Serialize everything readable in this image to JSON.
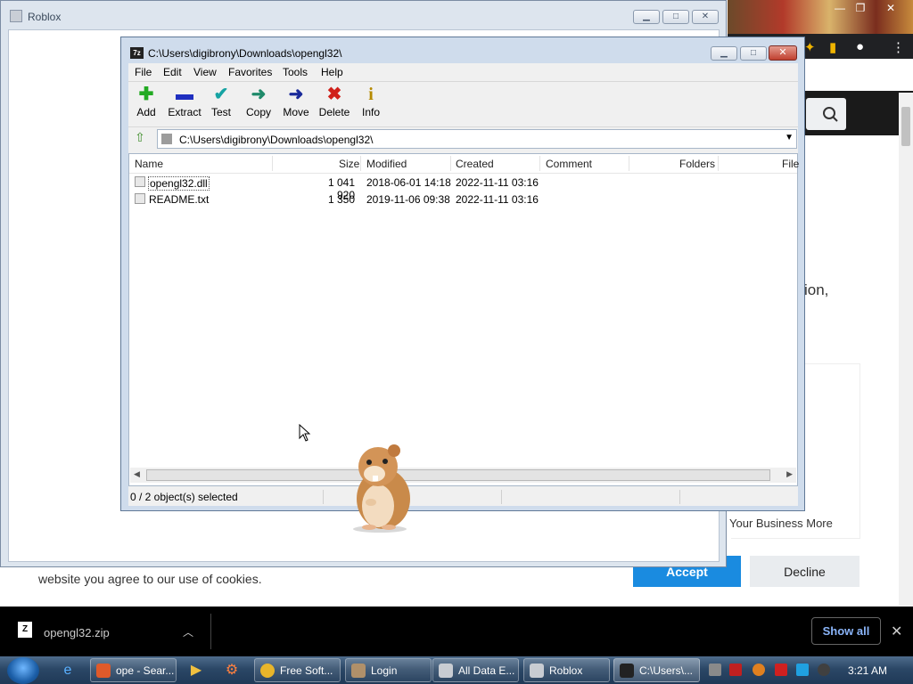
{
  "roblox_window": {
    "title": "Roblox"
  },
  "zip_window": {
    "title": "C:\\Users\\digibrony\\Downloads\\opengl32\\",
    "menu": [
      "File",
      "Edit",
      "View",
      "Favorites",
      "Tools",
      "Help"
    ],
    "toolbar": [
      {
        "label": "Add",
        "icon": "plus-icon",
        "glyph": "+",
        "color": "#22aa22"
      },
      {
        "label": "Extract",
        "icon": "minus-icon",
        "glyph": "▬",
        "color": "#1f2fbf"
      },
      {
        "label": "Test",
        "icon": "check-icon",
        "glyph": "✔",
        "color": "#16a3a3"
      },
      {
        "label": "Copy",
        "icon": "copy-arrow-icon",
        "glyph": "➜",
        "color": "#1f8a6a"
      },
      {
        "label": "Move",
        "icon": "move-arrow-icon",
        "glyph": "➜",
        "color": "#1a2a9a"
      },
      {
        "label": "Delete",
        "icon": "delete-x-icon",
        "glyph": "✖",
        "color": "#d0201a"
      },
      {
        "label": "Info",
        "icon": "info-icon",
        "glyph": "i",
        "color": "#b58a00"
      }
    ],
    "path": "C:\\Users\\digibrony\\Downloads\\opengl32\\",
    "columns": [
      "Name",
      "Size",
      "Modified",
      "Created",
      "Comment",
      "Folders",
      "File"
    ],
    "files": [
      {
        "name": "opengl32.dll",
        "size": "1 041 920",
        "modified": "2018-06-01 14:18",
        "created": "2022-11-11 03:16"
      },
      {
        "name": "README.txt",
        "size": "1 350",
        "modified": "2019-11-06 09:38",
        "created": "2022-11-11 03:16"
      }
    ],
    "status": "0 / 2 object(s) selected"
  },
  "background_page": {
    "partial_text": "ion,",
    "card_text": "Your Business More",
    "cookie_text": "website you agree to our use of cookies.",
    "accept_label": "Accept",
    "decline_label": "Decline"
  },
  "download_bar": {
    "file_name": "opengl32.zip",
    "show_all_label": "Show all"
  },
  "taskbar": {
    "tasks": [
      {
        "label": "ope - Sear...",
        "icon": "search-app-icon",
        "color": "#e05a2a"
      },
      {
        "label": "Free Soft...",
        "icon": "chrome-icon",
        "color": "#e8b52a"
      },
      {
        "label": "Login",
        "icon": "login-app-icon",
        "color": "#b0906a"
      },
      {
        "label": "All Data E...",
        "icon": "window-icon",
        "color": "#c8ccd2"
      },
      {
        "label": "Roblox",
        "icon": "roblox-icon",
        "color": "#c8ccd2"
      },
      {
        "label": "C:\\Users\\...",
        "icon": "7zip-icon",
        "color": "#222222"
      }
    ],
    "clock": "3:21 AM"
  }
}
